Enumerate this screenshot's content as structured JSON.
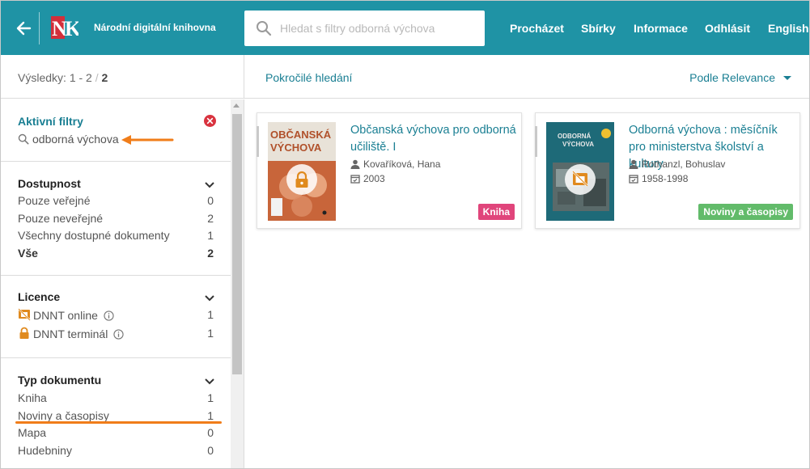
{
  "header": {
    "brand": "Národní digitální knihovna",
    "logo_letters": "NK",
    "search_placeholder": "Hledat s filtry odborná výchova",
    "nav": [
      "Procházet",
      "Sbírky",
      "Informace",
      "Odhlásit",
      "English"
    ]
  },
  "results": {
    "label": "Výsledky:",
    "range": "1 - 2",
    "sep": "/",
    "total": "2"
  },
  "toolbar": {
    "advanced_search": "Pokročilé hledání",
    "sort": "Podle Relevance"
  },
  "active_filters": {
    "title": "Aktivní filtry",
    "query": "odborná výchova"
  },
  "availability": {
    "title": "Dostupnost",
    "items": [
      {
        "label": "Pouze veřejné",
        "count": "0"
      },
      {
        "label": "Pouze neveřejné",
        "count": "2"
      },
      {
        "label": "Všechny dostupné dokumenty",
        "count": "1"
      },
      {
        "label": "Vše",
        "count": "2"
      }
    ]
  },
  "license": {
    "title": "Licence",
    "items": [
      {
        "label": "DNNT online",
        "count": "1",
        "icon": "dnnt-online-icon"
      },
      {
        "label": "DNNT terminál",
        "count": "1",
        "icon": "lock-icon"
      }
    ]
  },
  "doctype": {
    "title": "Typ dokumentu",
    "items": [
      {
        "label": "Kniha",
        "count": "1"
      },
      {
        "label": "Noviny a časopisy",
        "count": "1"
      },
      {
        "label": "Mapa",
        "count": "0"
      },
      {
        "label": "Hudebniny",
        "count": "0"
      }
    ]
  },
  "documents": [
    {
      "title": "Občanská výchova pro odborná učiliště. I",
      "author": "Kovaříková, Hana",
      "date": "2003",
      "badge": "Kniha",
      "badge_color": "#e0457b",
      "cover_text": [
        "OBČANSKÁ",
        "VÝCHOVA"
      ]
    },
    {
      "title": "Odborná výchova : měsíčník pro ministerstva školství a kultury",
      "author": "Rothanzl, Bohuslav",
      "date": "1958-1998",
      "badge": "Noviny a časopisy",
      "badge_color": "#62bb6a",
      "cover_text": [
        "ODBORNÁ",
        "VÝCHOVA"
      ]
    }
  ],
  "colors": {
    "header": "#1f93a5",
    "link": "#1a7f93",
    "annotation": "#f07d1a",
    "remove": "#d9333f",
    "lock": "#e08a1e"
  }
}
